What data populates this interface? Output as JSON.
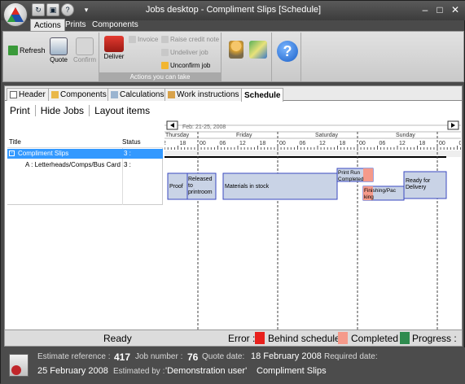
{
  "window": {
    "title": "Jobs desktop - Compliment Slips [Schedule]"
  },
  "ribbon_tabs": [
    {
      "label": "Actions"
    },
    {
      "label": "Prints"
    },
    {
      "label": "Components"
    }
  ],
  "ribbon": {
    "refresh": "Refresh",
    "quote": "Quote",
    "confirm": "Confirm",
    "deliver": "Deliver",
    "invoice": "Invoice",
    "raise_credit_note": "Raise credit note",
    "undeliver_job": "Undeliver job",
    "unconfirm_job": "Unconfirm job",
    "group_label": "Actions you can take"
  },
  "content_tabs": [
    {
      "label": "Header"
    },
    {
      "label": "Components"
    },
    {
      "label": "Calculations"
    },
    {
      "label": "Work instructions"
    },
    {
      "label": "Schedule"
    }
  ],
  "subtoolbar": {
    "print": "Print",
    "hide_jobs": "Hide Jobs",
    "layout_items": "Layout items"
  },
  "tree": {
    "col_title": "Title",
    "col_status": "Status",
    "rows": [
      {
        "title": "Compliment Slips",
        "status": "3 :"
      },
      {
        "title": "A : Letterheads/Comps/Bus Card",
        "status": "3 :"
      }
    ]
  },
  "gantt": {
    "range": "Feb: 21-25, 2008",
    "days": [
      "Thursday",
      "Friday",
      "Saturday",
      "Sunday"
    ],
    "hours": [
      "12",
      "18",
      "00",
      "06",
      "12",
      "18",
      "00",
      "06",
      "12",
      "18",
      "00",
      "06",
      "12",
      "18",
      "00",
      "06",
      "12",
      "18",
      "00"
    ],
    "tasks": [
      {
        "label": "Proof"
      },
      {
        "label": "Released to printroom"
      },
      {
        "label": "Materials in stock"
      },
      {
        "label": "Print Run Completed"
      },
      {
        "label": "Finishing/Packing"
      },
      {
        "label": "Ready for Delivery"
      }
    ]
  },
  "status": {
    "ready": "Ready",
    "error": "Error :",
    "behind": "Behind schedule :",
    "completed": "Completed :",
    "progress": "Progress :",
    "colors": {
      "error": "#e8201c",
      "behind": "#f59a8a",
      "completed": "#2e8b4e"
    }
  },
  "info": {
    "estimate_ref_label": "Estimate reference :",
    "estimate_ref": "417",
    "job_number_label": "Job number :",
    "job_number": "76",
    "quote_date_label": "Quote date:",
    "quote_date": "18 February 2008",
    "required_date_label": "Required date:",
    "required_date": "25 February 2008",
    "estimated_by_label": "Estimated by :",
    "estimated_by": "'Demonstration user'",
    "job_title": "Compliment Slips"
  }
}
